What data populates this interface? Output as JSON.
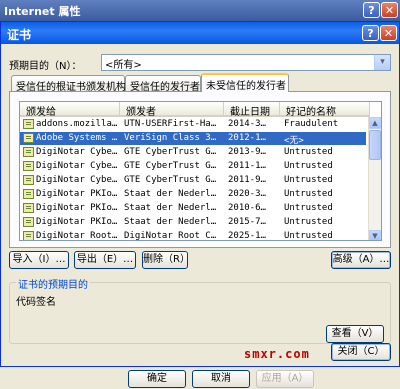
{
  "parent_window": {
    "title": "Internet 属性",
    "help_label": "?",
    "close_label": "✕",
    "buttons": {
      "ok": "确定",
      "cancel": "取消",
      "apply": "应用（A）"
    }
  },
  "dialog": {
    "title": "证书",
    "help_label": "?",
    "close_label": "✕",
    "purpose_label": "预期目的（N）：",
    "purpose_value": "<所有>",
    "combo_arrow": "▾",
    "tabs": [
      "受信任的根证书颁发机构",
      "受信任的发行者",
      "未受信任的发行者"
    ],
    "active_tab": 2,
    "columns": [
      "颁发给",
      "颁发者",
      "截止日期",
      "好记的名称"
    ],
    "rows": [
      [
        "addons.mozilla…",
        "UTN-USERFirst-Ha…",
        "2014-3…",
        "Fraudulent"
      ],
      [
        "Adobe Systems …",
        "VeriSign Class 3…",
        "2012-1…",
        "<无>"
      ],
      [
        "DigiNotar Cybe…",
        "GTE CyberTrust G…",
        "2013-9…",
        "Untrusted"
      ],
      [
        "DigiNotar Cybe…",
        "GTE CyberTrust G…",
        "2011-1…",
        "Untrusted"
      ],
      [
        "DigiNotar Cybe…",
        "GTE CyberTrust G…",
        "2011-9…",
        "Untrusted"
      ],
      [
        "DigiNotar PKIo…",
        "Staat der Nederl…",
        "2020-3…",
        "Untrusted"
      ],
      [
        "DigiNotar PKIo…",
        "Staat der Nederl…",
        "2010-6…",
        "Untrusted"
      ],
      [
        "DigiNotar PKIo…",
        "Staat der Nederl…",
        "2015-7…",
        "Untrusted"
      ],
      [
        "DigiNotar Root…",
        "DigiNotar Root C…",
        "2025-1…",
        "Untrusted"
      ]
    ],
    "selected_row": 1,
    "scroll_up": "▲",
    "scroll_down": "▼",
    "buttons": {
      "import": "导入（I）…",
      "export": "导出（E）…",
      "remove": "删除（R）",
      "advanced": "高级（A）…",
      "view": "查看（V）",
      "close": "关闭（C）"
    },
    "purposes_group": {
      "legend": "证书的预期目的",
      "value": "代码签名"
    }
  },
  "watermark": "smxr.com"
}
